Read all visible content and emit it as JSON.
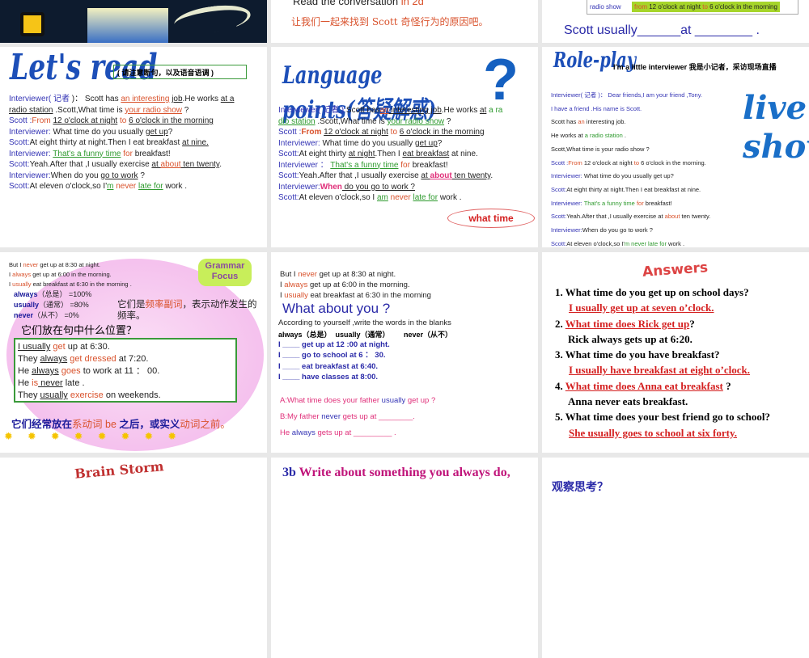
{
  "slides": {
    "s1": {},
    "s2": {
      "line1": [
        {
          "t": "Read the conversation ",
          "c": "k"
        },
        {
          "t": "in 2d",
          "c": "r"
        }
      ],
      "line2": "让我们一起来找到 Scott  奇怪行为的原因吧。"
    },
    "s3": {
      "cell_label": "radio show",
      "cell_value": [
        {
          "t": "from",
          "c": "r"
        },
        {
          "t": " 12 o'clock at night ",
          "c": "k"
        },
        {
          "t": "to",
          "c": "r"
        },
        {
          "t": " 6 o'clock in the morning",
          "c": "k"
        }
      ],
      "sentence": "Scott  usually______at  ________ ."
    },
    "s4": {
      "title": "Let's read",
      "note": "( 请注意断句，以及语音语调 )",
      "lines": [
        [
          {
            "t": "Interviewer( ",
            "c": "b"
          },
          {
            "t": "记者",
            "c": "b"
          },
          {
            "t": " )：  Scott has ",
            "c": "k"
          },
          {
            "t": "an interesting",
            "c": "r u"
          },
          {
            "t": " ",
            "c": "k"
          },
          {
            "t": "job",
            "c": "k u"
          },
          {
            "t": ".He works ",
            "c": "k"
          },
          {
            "t": "at a",
            "c": "k u"
          }
        ],
        [
          {
            "t": "radio station",
            "c": "k u"
          },
          {
            "t": " .Scott,What time is ",
            "c": "k"
          },
          {
            "t": "your radio show",
            "c": "r u"
          },
          {
            "t": " ?",
            "c": "k"
          }
        ],
        [
          {
            "t": "Scott :",
            "c": "b"
          },
          {
            "t": "From ",
            "c": "r"
          },
          {
            "t": "12 o'clock at night",
            "c": "k u"
          },
          {
            "t": " to ",
            "c": "r"
          },
          {
            "t": "6 o'clock in the morning",
            "c": "k u"
          }
        ],
        [
          {
            "t": "Interviewer: ",
            "c": "b"
          },
          {
            "t": "What time do you  usually ",
            "c": "k"
          },
          {
            "t": "get up",
            "c": "k u"
          },
          {
            "t": "?",
            "c": "k"
          }
        ],
        [
          {
            "t": "Scott:",
            "c": "b"
          },
          {
            "t": "At  eight thirty at night.Then I eat breakfast ",
            "c": "k"
          },
          {
            "t": "at nine.",
            "c": "k u"
          }
        ],
        [
          {
            "t": "Interviewer: ",
            "c": "b"
          },
          {
            "t": "That's a funny time",
            "c": "g u"
          },
          {
            "t": " for ",
            "c": "r"
          },
          {
            "t": "breakfast!",
            "c": "k"
          }
        ],
        [
          {
            "t": "Scott:",
            "c": "b"
          },
          {
            "t": "Yeah.After that ,I usually exercise ",
            "c": "k"
          },
          {
            "t": "at ",
            "c": "k u"
          },
          {
            "t": "about",
            "c": "r u"
          },
          {
            "t": " ten twenty",
            "c": "k u"
          },
          {
            "t": ".",
            "c": "k"
          }
        ],
        [
          {
            "t": "Interviewer:",
            "c": "b"
          },
          {
            "t": "When do you ",
            "c": "k"
          },
          {
            "t": "go to work",
            "c": "k u"
          },
          {
            "t": " ?",
            "c": "k"
          }
        ],
        [
          {
            "t": "Scott:",
            "c": "b"
          },
          {
            "t": "At eleven o'clock,so I'",
            "c": "k"
          },
          {
            "t": "m",
            "c": "g u"
          },
          {
            "t": " never ",
            "c": "r"
          },
          {
            "t": "late for",
            "c": "g u"
          },
          {
            "t": " work .",
            "c": "k"
          }
        ]
      ]
    },
    "s5": {
      "title": "Language points(答疑解惑)",
      "callout": "what time",
      "lines": [
        [
          {
            "t": "Interviewer( 记者 ):",
            "c": "b"
          },
          {
            "t": "Scott has",
            "c": "k"
          },
          {
            "t": "an",
            "c": "r u"
          },
          {
            "t": " interesting job",
            "c": "k u"
          },
          {
            "t": ".He works ",
            "c": "k"
          },
          {
            "t": "at",
            "c": "k u"
          },
          {
            "t": " a ra",
            "c": "g"
          }
        ],
        [
          {
            "t": "dio station",
            "c": "g u"
          },
          {
            "t": " .Scott,What time is ",
            "c": "k"
          },
          {
            "t": "your radio show",
            "c": "g u"
          },
          {
            "t": " ?",
            "c": "k"
          }
        ],
        [
          {
            "t": "Scott :",
            "c": "b"
          },
          {
            "t": "From ",
            "c": "r bold"
          },
          {
            "t": "12 o'clock at night",
            "c": "k u"
          },
          {
            "t": " to ",
            "c": "r"
          },
          {
            "t": "6 o'clock in the morning",
            "c": "k u"
          }
        ],
        [
          {
            "t": "Interviewer: ",
            "c": "b"
          },
          {
            "t": "What time do you  usually ",
            "c": "k"
          },
          {
            "t": "get up",
            "c": "k u"
          },
          {
            "t": "?",
            "c": "k"
          }
        ],
        [
          {
            "t": "Scott:",
            "c": "b"
          },
          {
            "t": "At  eight thirty ",
            "c": "k"
          },
          {
            "t": "at night",
            "c": "k u"
          },
          {
            "t": ".Then I ",
            "c": "k"
          },
          {
            "t": "eat breakfast",
            "c": "k u"
          },
          {
            "t": " at nine.",
            "c": "k"
          }
        ],
        [
          {
            "t": "Interviewer ： ",
            "c": "b"
          },
          {
            "t": "That's a funny time",
            "c": "g u"
          },
          {
            "t": " for ",
            "c": "r"
          },
          {
            "t": "breakfast!",
            "c": "k"
          }
        ],
        [
          {
            "t": "Scott:",
            "c": "b"
          },
          {
            "t": "Yeah.After that ,I usually exercise ",
            "c": "k"
          },
          {
            "t": "at ",
            "c": "k u"
          },
          {
            "t": "about",
            "c": "p bold u"
          },
          {
            "t": " ten twenty",
            "c": "k u"
          },
          {
            "t": ".",
            "c": "k"
          }
        ],
        [
          {
            "t": "Interviewer:",
            "c": "b"
          },
          {
            "t": "When",
            "c": "p bold"
          },
          {
            "t": " do you go to work ?",
            "c": "k u"
          }
        ],
        [
          {
            "t": "Scott:",
            "c": "b"
          },
          {
            "t": "At eleven o'clock,so I ",
            "c": "k"
          },
          {
            "t": "am",
            "c": "g u"
          },
          {
            "t": " never ",
            "c": "r"
          },
          {
            "t": "late for",
            "c": "g u"
          },
          {
            "t": " work .",
            "c": "k"
          }
        ]
      ]
    },
    "s6": {
      "title": "Role-play",
      "subtitle": "I'm a little interviewer 我是小记者，采访现场直播",
      "live": "live",
      "show": "show",
      "lines": [
        [
          {
            "t": "Interviewer( 记者 )：  Dear friends,I am your friend ,Tony.",
            "c": "b"
          }
        ],
        [
          {
            "t": "I have a friend .His name is Scott.",
            "c": "b"
          }
        ],
        [
          {
            "t": "Scott has ",
            "c": "k"
          },
          {
            "t": "an",
            "c": "r"
          },
          {
            "t": " interesting job.",
            "c": "k"
          }
        ],
        [
          {
            "t": "He works at ",
            "c": "k"
          },
          {
            "t": "a radio station",
            "c": "g"
          },
          {
            "t": " .",
            "c": "k"
          }
        ],
        [
          {
            "t": "Scott,What time is your radio show ?",
            "c": "k"
          }
        ],
        [
          {
            "t": "Scott :",
            "c": "b"
          },
          {
            "t": "From",
            "c": "r"
          },
          {
            "t": " 12 o'clock at night ",
            "c": "k"
          },
          {
            "t": "to",
            "c": "r"
          },
          {
            "t": " 6 o'clock in the morning.",
            "c": "k"
          }
        ],
        [
          {
            "t": "Interviewer: ",
            "c": "b"
          },
          {
            "t": "What time do you  usually get up?",
            "c": "k"
          }
        ],
        [
          {
            "t": "Scott:",
            "c": "b"
          },
          {
            "t": "At  eight thirty at night.Then I eat breakfast at nine.",
            "c": "k"
          }
        ],
        [
          {
            "t": "Interviewer: ",
            "c": "b"
          },
          {
            "t": "That's a funny time ",
            "c": "g"
          },
          {
            "t": "for",
            "c": "r"
          },
          {
            "t": " breakfast!",
            "c": "k"
          }
        ],
        [
          {
            "t": "Scott:",
            "c": "b"
          },
          {
            "t": "Yeah.After that ,I usually exercise at ",
            "c": "k"
          },
          {
            "t": "about",
            "c": "r"
          },
          {
            "t": " ten twenty.",
            "c": "k"
          }
        ],
        [
          {
            "t": "Interviewer:",
            "c": "b"
          },
          {
            "t": "When do you go to work ?",
            "c": "k"
          }
        ],
        [
          {
            "t": "Scott:",
            "c": "b"
          },
          {
            "t": "At eleven o'clock,so I'",
            "c": "k"
          },
          {
            "t": "m never late for",
            "c": "g"
          },
          {
            "t": " work .",
            "c": "k"
          }
        ]
      ]
    },
    "s7": {
      "badge": "Grammar Focus",
      "top": [
        [
          {
            "t": "But I ",
            "c": "k"
          },
          {
            "t": "never",
            "c": "r"
          },
          {
            "t": " get up at 8:30 at night.",
            "c": "k"
          }
        ],
        [
          {
            "t": "    I ",
            "c": "k"
          },
          {
            "t": "always",
            "c": "r"
          },
          {
            "t": " get up at 6:00 in the morning.",
            "c": "k"
          }
        ],
        [
          {
            "t": "    I ",
            "c": "k"
          },
          {
            "t": "usually",
            "c": "r"
          },
          {
            "t": "  eat breakfast at 6:30 in the  morning .",
            "c": "k"
          }
        ]
      ],
      "freq": [
        [
          {
            "t": "always",
            "c": "db"
          },
          {
            "t": "（总是）   =100%",
            "c": "k"
          }
        ],
        [
          {
            "t": "usually",
            "c": "db"
          },
          {
            "t": "（通常）   =80%",
            "c": "k"
          }
        ],
        [
          {
            "t": "never",
            "c": "db"
          },
          {
            "t": "（从不）   =0%",
            "c": "k"
          }
        ]
      ],
      "desc": [
        {
          "t": "它们是",
          "c": "k"
        },
        {
          "t": "频率副词",
          "c": "r"
        },
        {
          "t": "，表示动作发生的频率。",
          "c": "k"
        }
      ],
      "question": "它们放在句中什么位置？",
      "box": [
        [
          {
            "t": "I usually",
            "c": "k u"
          },
          {
            "t": " get",
            "c": "r"
          },
          {
            "t": " up at 6:30.",
            "c": "k"
          }
        ],
        [
          {
            "t": "They  ",
            "c": "k"
          },
          {
            "t": "always",
            "c": "k u"
          },
          {
            "t": " get dressed",
            "c": "r"
          },
          {
            "t": "  at   7:20.",
            "c": "k"
          }
        ],
        [
          {
            "t": "He ",
            "c": "k"
          },
          {
            "t": "always",
            "c": "k u"
          },
          {
            "t": " goes",
            "c": "r"
          },
          {
            "t": " to work at 11 ：  00.",
            "c": "k"
          }
        ],
        [
          {
            "t": "He ",
            "c": "k"
          },
          {
            "t": "is",
            "c": "r"
          },
          {
            "t": " never",
            "c": "k u"
          },
          {
            "t": " late .",
            "c": "k"
          }
        ],
        [
          {
            "t": "They ",
            "c": "k"
          },
          {
            "t": "usually",
            "c": "k u"
          },
          {
            "t": " exercise",
            "c": "r"
          },
          {
            "t": " on weekends.",
            "c": "k"
          }
        ]
      ],
      "rule": [
        {
          "t": "它们经常放在",
          "c": "db"
        },
        {
          "t": "系动词 be",
          "c": "r"
        },
        {
          "t": " 之后，或实义",
          "c": "db"
        },
        {
          "t": "动词之前。",
          "c": "r"
        }
      ]
    },
    "s8": {
      "top": [
        [
          {
            "t": "But I ",
            "c": "k"
          },
          {
            "t": "never",
            "c": "r"
          },
          {
            "t": " get up at 8:30 at night.",
            "c": "k"
          }
        ],
        [
          {
            "t": "     I ",
            "c": "k"
          },
          {
            "t": "always",
            "c": "r"
          },
          {
            "t": " get up at 6:00 in the morning.",
            "c": "k"
          }
        ],
        [
          {
            "t": "     I ",
            "c": "k"
          },
          {
            "t": "usually",
            "c": "r"
          },
          {
            "t": "  eat breakfast at 6:30 in the  morning",
            "c": "k"
          }
        ]
      ],
      "heading": "What about you ?",
      "instruction": "According to yourself ,write the words in the blanks",
      "words": "always（总是）  usually（通常）       never（从不）",
      "blanks": [
        "I ____ get up at 12 :00 at night.",
        "I ____  go to school at 6 ：  30.",
        "I ____ eat  breakfast at 6:40.",
        "I ____  have classes at 8:00."
      ],
      "dialog": [
        [
          {
            "t": "A:What time does your father ",
            "c": "p"
          },
          {
            "t": "usually",
            "c": "b"
          },
          {
            "t": " get up ?",
            "c": "p"
          }
        ],
        [
          {
            "t": "B:My father ",
            "c": "p"
          },
          {
            "t": "never",
            "c": "b"
          },
          {
            "t": " gets up at ________.",
            "c": "p"
          }
        ],
        [
          {
            "t": "   He ",
            "c": "p"
          },
          {
            "t": "always",
            "c": "b"
          },
          {
            "t": " gets up at  _________ .",
            "c": "p"
          }
        ]
      ]
    },
    "s9": {
      "title": "Answers",
      "items": [
        {
          "q": "1. What time do you get up on school days?",
          "a": "I usually get up at seven o’clock.",
          "qa": "q"
        },
        {
          "q": "2. ",
          "a": "What time does Rick get up",
          "tail": "?",
          "qa": "a"
        },
        {
          "q": "Rick always gets up at 6:20.",
          "qa": "plain"
        },
        {
          "q": "3. What time do you have breakfast?",
          "a": "I usually have breakfast at eight o’clock.",
          "qa": "q"
        },
        {
          "q": "4. ",
          "a": "What time does Anna eat breakfast",
          "tail": " ?",
          "qa": "a"
        },
        {
          "q": "Anna never eats breakfast.",
          "qa": "plain"
        },
        {
          "q": "5. What time does your best friend go to school?",
          "a": "She usually goes to school at six forty.",
          "qa": "q"
        }
      ]
    },
    "s10": {
      "title": "Brain Storm"
    },
    "s11": {
      "num": "3b",
      "title": "Write about something you always do,"
    },
    "s12": {
      "title": "观察思考？"
    }
  }
}
